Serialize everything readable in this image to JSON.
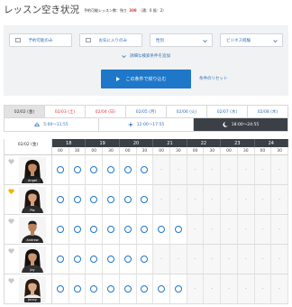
{
  "page": {
    "title": "レッスン空き状況",
    "remaining_label": "予約可能レッスン数：残り",
    "remaining_count": "308",
    "remaining_breakdown": "（通：0 振：2）"
  },
  "filters": {
    "available_only": {
      "label": "予約可能のみ",
      "checked": false
    },
    "favorites_only": {
      "label": "お気に入りのみ",
      "checked": false
    },
    "gender": {
      "label": "性別",
      "icon": "chevron-down-icon"
    },
    "business_experience": {
      "label": "ビジネス経験",
      "icon": "chevron-down-icon"
    },
    "advanced_search": {
      "label": "詳細な検索条件を追加",
      "icon": "chevron-down-icon"
    },
    "apply_button": {
      "label": "この条件で絞り込む",
      "icon": "play-triangle-icon"
    },
    "reset_link": {
      "label": "条件のリセット"
    }
  },
  "date_tabs": [
    {
      "label": "02/02 (金)",
      "selected": true
    },
    {
      "label": "02/03 (土)",
      "selected": false
    },
    {
      "label": "02/04 (日)",
      "selected": false
    },
    {
      "label": "02/05 (月)",
      "selected": false
    },
    {
      "label": "02/06 (火)",
      "selected": false
    },
    {
      "label": "02/07 (水)",
      "selected": false
    },
    {
      "label": "02/08 (木)",
      "selected": false
    }
  ],
  "time_tabs": [
    {
      "label": "5:00〜11:55",
      "icon": "sunrise-icon",
      "selected": false
    },
    {
      "label": "12:00〜17:55",
      "icon": "sun-icon",
      "selected": false
    },
    {
      "label": "18:00〜24:55",
      "icon": "moon-icon",
      "selected": true
    }
  ],
  "schedule": {
    "date_label": "02/02 (金)",
    "hours": [
      "18",
      "19",
      "20",
      "21",
      "22",
      "23",
      "24"
    ],
    "minutes": [
      "00",
      "30"
    ],
    "available_icon": "circle-icon",
    "unavailable_mark": "-",
    "teachers": [
      {
        "name": "Angel",
        "favorite": false,
        "slots": [
          true,
          true,
          true,
          true,
          true,
          true,
          false,
          false,
          false,
          false,
          false,
          false,
          false,
          false
        ]
      },
      {
        "name": "Pia",
        "favorite": true,
        "slots": [
          true,
          true,
          true,
          true,
          true,
          true,
          false,
          false,
          false,
          false,
          false,
          false,
          false,
          false
        ]
      },
      {
        "name": "Andrew",
        "favorite": false,
        "slots": [
          true,
          true,
          true,
          true,
          true,
          true,
          true,
          true,
          false,
          false,
          false,
          false,
          false,
          false
        ]
      },
      {
        "name": "Joy",
        "favorite": false,
        "slots": [
          true,
          true,
          true,
          true,
          true,
          true,
          false,
          false,
          false,
          false,
          false,
          false,
          false,
          false
        ]
      },
      {
        "name": "Jenny",
        "favorite": false,
        "slots": [
          true,
          true,
          true,
          true,
          true,
          true,
          true,
          true,
          false,
          false,
          false,
          false,
          false,
          false
        ]
      }
    ]
  },
  "colors": {
    "primary": "#1f77c9",
    "link": "#2f6fb5",
    "weekend": "#e0393e",
    "selected_dark": "#3b4046",
    "favorite": "#f0b400",
    "heart_default": "#c8c8c8",
    "count_highlight": "#e0393e"
  }
}
